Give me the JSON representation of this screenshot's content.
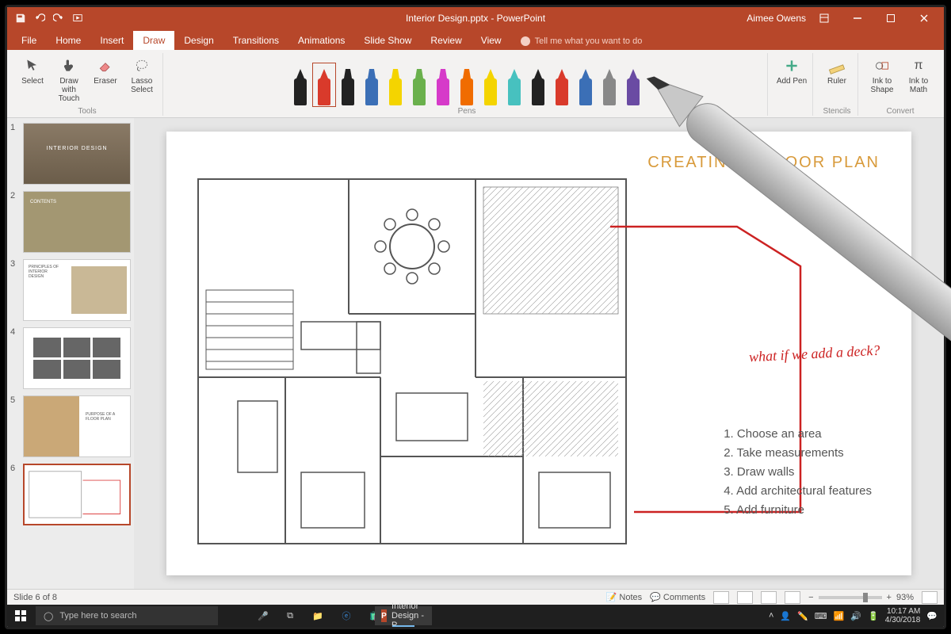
{
  "titlebar": {
    "doc_title": "Interior Design.pptx - PowerPoint",
    "user_name": "Aimee Owens"
  },
  "tabs": {
    "file": "File",
    "home": "Home",
    "insert": "Insert",
    "draw": "Draw",
    "design": "Design",
    "transitions": "Transitions",
    "animations": "Animations",
    "slideshow": "Slide Show",
    "review": "Review",
    "view": "View",
    "tellme": "Tell me what you want to do"
  },
  "ribbon": {
    "tools_group": "Tools",
    "pens_group": "Pens",
    "stencils_group": "Stencils",
    "convert_group": "Convert",
    "select": "Select",
    "draw_touch": "Draw with Touch",
    "eraser": "Eraser",
    "lasso": "Lasso Select",
    "add_pen": "Add Pen",
    "ruler": "Ruler",
    "ink_shape": "Ink to Shape",
    "ink_math": "Ink to Math",
    "pens": [
      {
        "color": "#222",
        "type": "fine",
        "selected": false
      },
      {
        "color": "#d93a2b",
        "type": "fine",
        "selected": true
      },
      {
        "color": "#222",
        "type": "highlighter",
        "selected": false
      },
      {
        "color": "#3b6fb6",
        "type": "highlighter",
        "selected": false
      },
      {
        "color": "#f4d400",
        "type": "highlighter",
        "selected": false
      },
      {
        "color": "#6ab04c",
        "type": "highlighter",
        "selected": false
      },
      {
        "color": "#d63ac9",
        "type": "highlighter",
        "selected": false
      },
      {
        "color": "#f06c00",
        "type": "highlighter",
        "selected": false
      },
      {
        "color": "#f4d400",
        "type": "fine",
        "selected": false
      },
      {
        "color": "#47c1bf",
        "type": "fine",
        "selected": false
      },
      {
        "color": "#222",
        "type": "fine",
        "selected": false
      },
      {
        "color": "#d93a2b",
        "type": "fine",
        "selected": false
      },
      {
        "color": "#3b6fb6",
        "type": "fine",
        "selected": false
      },
      {
        "color": "#888",
        "type": "fine",
        "selected": false
      },
      {
        "color": "#6a4ba3",
        "type": "fine",
        "selected": false
      }
    ]
  },
  "thumbs": {
    "items": [
      {
        "n": "1",
        "title": "INTERIOR DESIGN"
      },
      {
        "n": "2",
        "title": "CONTENTS"
      },
      {
        "n": "3",
        "title": "PRINCIPLES OF INTERIOR DESIGN"
      },
      {
        "n": "4",
        "title": ""
      },
      {
        "n": "5",
        "title": "PURPOSE OF A FLOOR PLAN"
      },
      {
        "n": "6",
        "title": ""
      }
    ]
  },
  "slide": {
    "heading": "CREATING A FLOOR PLAN",
    "annotation": "what if we add a deck?",
    "steps": [
      "1. Choose an area",
      "2. Take measurements",
      "3. Draw walls",
      "4. Add architectural features",
      "5. Add furniture"
    ]
  },
  "status": {
    "slide_pos": "Slide 6 of 8",
    "notes": "Notes",
    "comments": "Comments",
    "zoom": "93%"
  },
  "taskbar": {
    "search_placeholder": "Type here to search",
    "app_title": "Interior Design - P...",
    "time": "10:17 AM",
    "date": "4/30/2018"
  }
}
